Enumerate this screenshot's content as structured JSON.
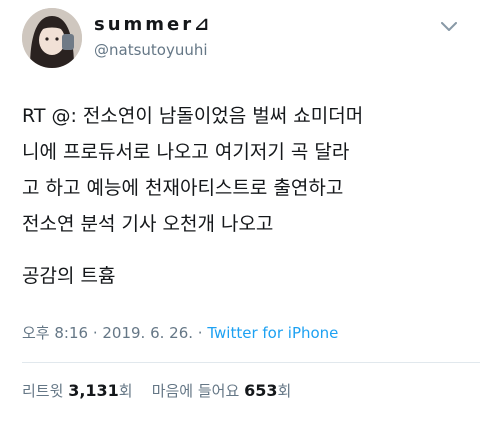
{
  "user": {
    "display_name": "summer⊿",
    "handle": "@natsutoyuuhi"
  },
  "tweet": {
    "text": "RT @: 전소연이 남돌이었음 벌써 쇼미더머\n니에 프로듀서로 나오고 여기저기 곡 달라\n고 하고 예능에 천재아티스트로 출연하고\n전소연 분석 기사 오천개 나오고",
    "text_2": "공감의 트흄"
  },
  "meta": {
    "time": "오후 8:16",
    "separator_1": " · ",
    "date": "2019. 6. 26.",
    "separator_2": " · ",
    "source": "Twitter for iPhone"
  },
  "stats": {
    "retweets_label": "리트윗",
    "retweets_count": "3,131",
    "retweets_unit": "회",
    "likes_label": "마음에 들어요",
    "likes_count": "653",
    "likes_unit": "회"
  },
  "icons": {
    "menu": "chevron-down-icon",
    "avatar": "avatar"
  },
  "colors": {
    "text": "#14171a",
    "secondary": "#657786",
    "link": "#1da1f2",
    "divider": "#e1e8ed"
  }
}
